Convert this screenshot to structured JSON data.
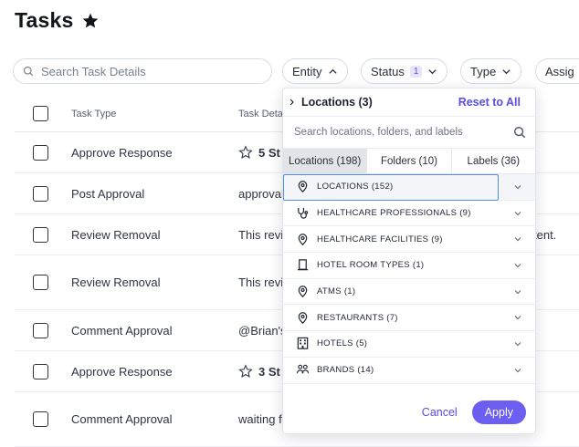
{
  "page": {
    "title": "Tasks"
  },
  "search": {
    "placeholder": "Search Task Details"
  },
  "filters": {
    "entity": "Entity",
    "status": "Status",
    "status_count": "1",
    "type": "Type",
    "assignee": "Assig"
  },
  "table": {
    "headers": {
      "type": "Task Type",
      "detail": "Task Deta"
    },
    "rows": [
      {
        "type": "Approve Response",
        "detail": "5 St",
        "star": true,
        "tail": ""
      },
      {
        "type": "Post Approval",
        "detail": "approval",
        "star": false,
        "tail": ""
      },
      {
        "type": "Review Removal",
        "detail": "This revi",
        "star": false,
        "tail": "tent."
      },
      {
        "type": "Review Removal",
        "detail": "This revi",
        "star": false,
        "tail": ""
      },
      {
        "type": "Comment Approval",
        "detail": "@Brian's",
        "star": false,
        "tail": ""
      },
      {
        "type": "Approve Response",
        "detail": "3 St",
        "star": true,
        "tail": ""
      },
      {
        "type": "Comment Approval",
        "detail": "waiting f",
        "star": false,
        "tail": ""
      }
    ]
  },
  "dropdown": {
    "breadcrumb": "Locations (3)",
    "reset": "Reset to All",
    "search_placeholder": "Search locations, folders, and labels",
    "tabs": [
      "Locations (198)",
      "Folders (10)",
      "Labels (36)"
    ],
    "items": [
      {
        "label": "LOCATIONS (152)",
        "icon": "pin-icon"
      },
      {
        "label": "HEALTHCARE PROFESSIONALS (9)",
        "icon": "stethoscope-icon"
      },
      {
        "label": "HEALTHCARE FACILITIES (9)",
        "icon": "pin-icon"
      },
      {
        "label": "HOTEL ROOM TYPES (1)",
        "icon": "door-icon"
      },
      {
        "label": "ATMS (1)",
        "icon": "pin-icon"
      },
      {
        "label": "RESTAURANTS (7)",
        "icon": "pin-icon"
      },
      {
        "label": "HOTELS (5)",
        "icon": "building-icon"
      },
      {
        "label": "BRANDS (14)",
        "icon": "people-icon"
      }
    ],
    "cancel": "Cancel",
    "apply": "Apply"
  },
  "colors": {
    "accent": "#6b5ef0",
    "focus": "#4f8fe8"
  }
}
